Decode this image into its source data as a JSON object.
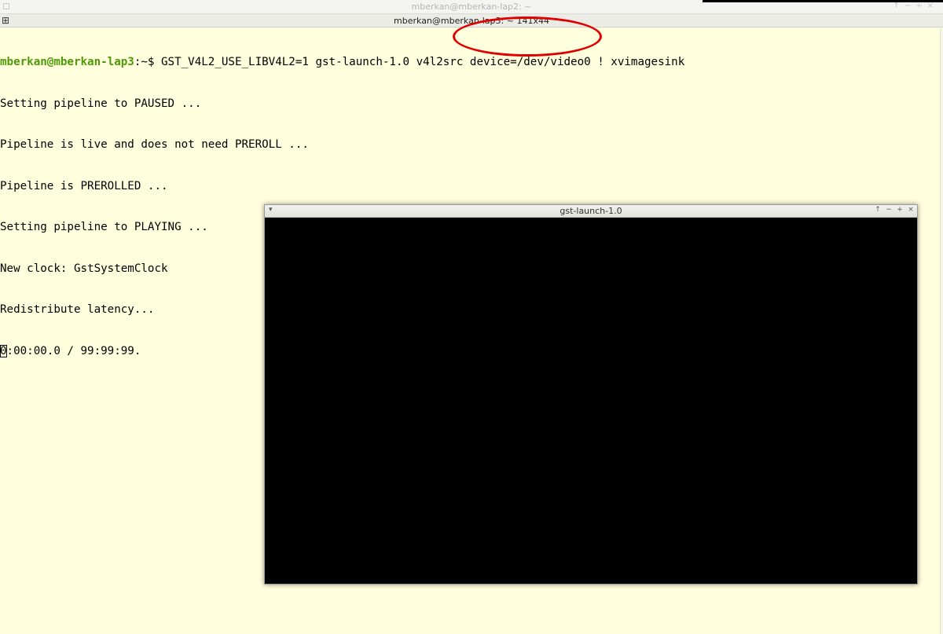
{
  "background_window": {
    "title": "mberkan@mberkan-lap2: ~",
    "buttons": [
      "↑",
      "−",
      "+",
      "×"
    ]
  },
  "terminal_window": {
    "title": "mberkan@mberkan-lap3: ~ 141x44",
    "menu_icon": "grid-menu-icon"
  },
  "terminal": {
    "prompt_user": "mberkan@mberkan-lap3",
    "prompt_rest": ":~$ ",
    "command": "GST_V4L2_USE_LIBV4L2=1 gst-launch-1.0 v4l2src device=/dev/video0 ! xvimagesink",
    "output": [
      "Setting pipeline to PAUSED ...",
      "Pipeline is live and does not need PREROLL ...",
      "Pipeline is PREROLLED ...",
      "Setting pipeline to PLAYING ...",
      "New clock: GstSystemClock",
      "Redistribute latency..."
    ],
    "progress_cursor": "0",
    "progress_rest": ":00:00.0 / 99:99:99."
  },
  "gst_window": {
    "title": "gst-launch-1.0",
    "menu": "▾",
    "btn_up": "↑",
    "btn_min": "−",
    "btn_max": "+",
    "btn_close": "×"
  },
  "colors": {
    "terminal_bg": "#ffffdd",
    "prompt": "#4e9a06",
    "annotation": "#e00000",
    "video_bg": "#000000"
  }
}
